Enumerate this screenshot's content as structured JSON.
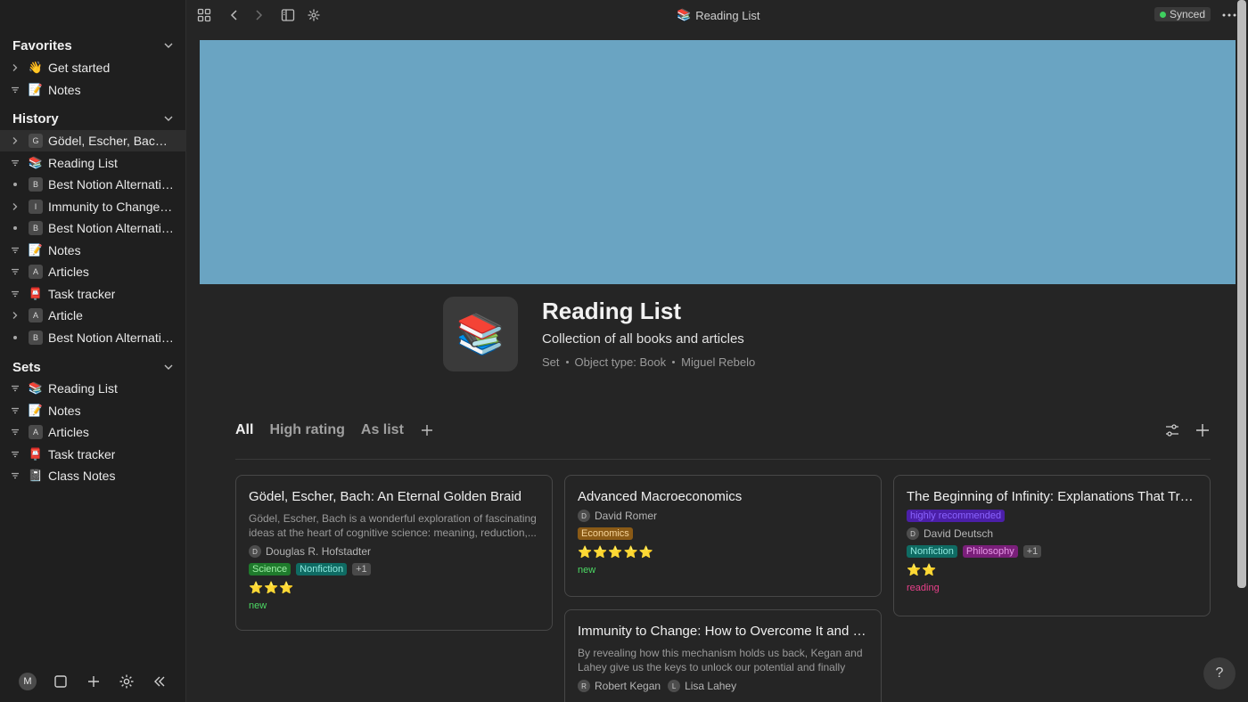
{
  "sidebar": {
    "favorites": {
      "title": "Favorites",
      "items": [
        {
          "label": "Get started",
          "icon": "👋",
          "mark": "chevron"
        },
        {
          "label": "Notes",
          "icon": "📝",
          "mark": "filter"
        }
      ]
    },
    "history": {
      "title": "History",
      "items": [
        {
          "label": "Gödel, Escher, Bach: ...",
          "letter": "G",
          "mark": "chevron"
        },
        {
          "label": "Reading List",
          "icon": "📚",
          "mark": "filter"
        },
        {
          "label": "Best Notion Alternativ...",
          "letter": "B",
          "mark": "dot"
        },
        {
          "label": "Immunity to Change: ...",
          "letter": "I",
          "mark": "chevron"
        },
        {
          "label": "Best Notion Alternativ...",
          "letter": "B",
          "mark": "dot"
        },
        {
          "label": "Notes",
          "icon": "📝",
          "mark": "filter"
        },
        {
          "label": "Articles",
          "letter": "A",
          "mark": "filter"
        },
        {
          "label": "Task tracker",
          "icon": "📮",
          "mark": "filter"
        },
        {
          "label": "Article",
          "letter": "A",
          "mark": "chevron"
        },
        {
          "label": "Best Notion Alternativ...",
          "letter": "B",
          "mark": "dot"
        }
      ]
    },
    "sets": {
      "title": "Sets",
      "items": [
        {
          "label": "Reading List",
          "icon": "📚",
          "mark": "filter"
        },
        {
          "label": "Notes",
          "icon": "📝",
          "mark": "filter"
        },
        {
          "label": "Articles",
          "letter": "A",
          "mark": "filter"
        },
        {
          "label": "Task tracker",
          "icon": "📮",
          "mark": "filter"
        },
        {
          "label": "Class Notes",
          "icon": "📓",
          "mark": "filter"
        }
      ]
    },
    "bottom": {
      "avatar_letter": "M"
    }
  },
  "topbar": {
    "title": "Reading List",
    "title_icon": "📚",
    "sync_status": "Synced"
  },
  "header": {
    "icon": "📚",
    "title": "Reading List",
    "description": "Collection of all books and articles",
    "meta": [
      "Set",
      "Object type: Book",
      "Miguel Rebelo"
    ]
  },
  "views": {
    "tabs": [
      "All",
      "High rating",
      "As list"
    ],
    "active": "All"
  },
  "cards": [
    {
      "title": "Gödel, Escher, Bach: An Eternal Golden Braid",
      "description": "Gödel, Escher, Bach is a wonderful exploration of fascinating ideas at the heart of cognitive science: meaning, reduction,...",
      "people": [
        {
          "initial": "D",
          "name": "Douglas R. Hofstadter"
        }
      ],
      "tags": [
        {
          "label": "Science",
          "bg": "#1f7a2c",
          "fg": "#9ff0a8"
        },
        {
          "label": "Nonfiction",
          "bg": "#0f6b63",
          "fg": "#8fe8de"
        },
        {
          "label": "+1",
          "bg": "#4a4a4a",
          "fg": "#bdbdbd"
        }
      ],
      "stars": "⭐⭐⭐",
      "status": {
        "label": "new",
        "color": "#4cd964"
      }
    },
    {
      "title": "Advanced Macroeconomics",
      "description": "",
      "people": [
        {
          "initial": "D",
          "name": "David Romer"
        }
      ],
      "tags": [
        {
          "label": "Economics",
          "bg": "#8a5a16",
          "fg": "#f6d49a"
        }
      ],
      "stars": "⭐⭐⭐⭐⭐",
      "status": {
        "label": "new",
        "color": "#4cd964"
      }
    },
    {
      "title": "The Beginning of Infinity: Explanations That Transform the World",
      "description": "",
      "highlight": {
        "label": "highly recommended",
        "bg": "#4b1fa8",
        "fg": "#8a63ff"
      },
      "people": [
        {
          "initial": "D",
          "name": "David Deutsch"
        }
      ],
      "tags": [
        {
          "label": "Nonfiction",
          "bg": "#0f6b63",
          "fg": "#8fe8de"
        },
        {
          "label": "Philosophy",
          "bg": "#7a1f7a",
          "fg": "#e89ae8"
        },
        {
          "label": "+1",
          "bg": "#4a4a4a",
          "fg": "#bdbdbd"
        }
      ],
      "stars": "⭐⭐",
      "status": {
        "label": "reading",
        "color": "#e8408a"
      }
    },
    {
      "title": "Immunity to Change: How to Overcome It and Unlock the Potential in Yourself and Your Organization",
      "description": "By revealing how this mechanism holds us back, Kegan and Lahey give us the keys to unlock our potential and finally mov...",
      "people": [
        {
          "initial": "R",
          "name": "Robert Kegan"
        },
        {
          "initial": "L",
          "name": "Lisa Lahey"
        }
      ],
      "tags": [],
      "stars": "",
      "status": null
    }
  ],
  "help": {
    "label": "?"
  }
}
